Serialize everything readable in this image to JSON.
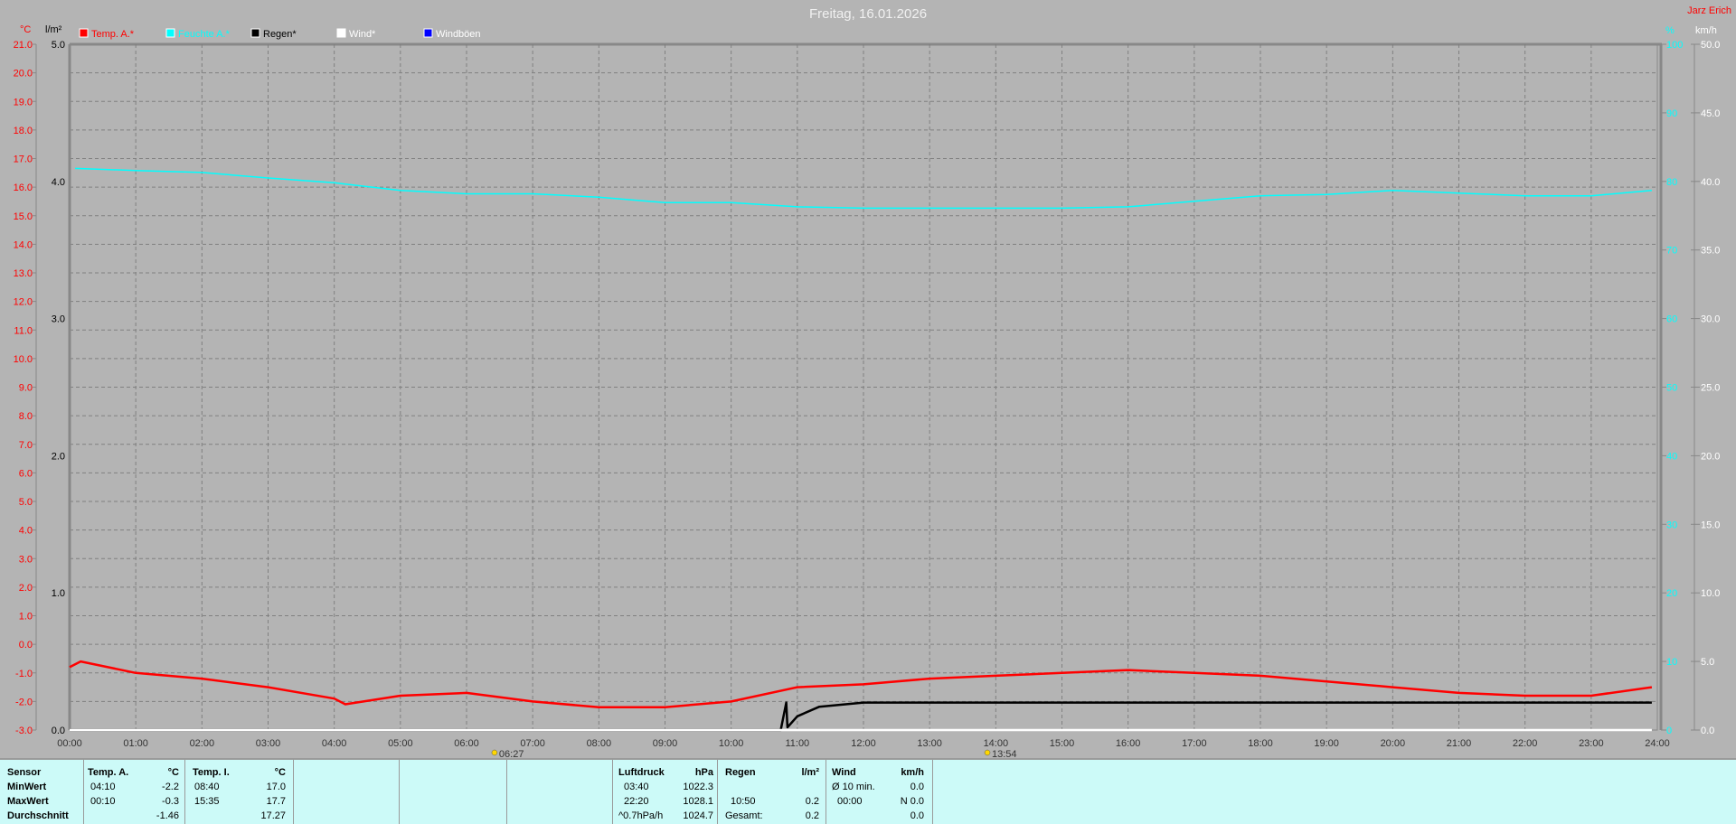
{
  "title": "Freitag, 16.01.2026",
  "station_owner": "Jarz Erich",
  "colors": {
    "temp": "#ff0000",
    "humidity": "#00ffff",
    "rain": "#000000",
    "wind": "#ffffff",
    "gusts": "#0000ff",
    "background": "#b4b4b4",
    "table": "#ccfaf8"
  },
  "chart_data": {
    "type": "line",
    "title": "Freitag, 16.01.2026",
    "x_ticks": [
      "00:00",
      "01:00",
      "02:00",
      "03:00",
      "04:00",
      "05:00",
      "06:00",
      "07:00",
      "08:00",
      "09:00",
      "10:00",
      "11:00",
      "12:00",
      "13:00",
      "14:00",
      "15:00",
      "16:00",
      "17:00",
      "18:00",
      "19:00",
      "20:00",
      "21:00",
      "22:00",
      "23:00",
      "24:00"
    ],
    "xlim_hours": [
      0,
      24
    ],
    "grid": true,
    "legend_placement": "top-left",
    "axes": {
      "temp": {
        "unit": "°C",
        "ylim": [
          -3,
          21
        ],
        "ticks": [
          "21.0",
          "20.0",
          "19.0",
          "18.0",
          "17.0",
          "16.0",
          "15.0",
          "14.0",
          "13.0",
          "12.0",
          "11.0",
          "10.0",
          "9.0",
          "8.0",
          "7.0",
          "6.0",
          "5.0",
          "4.0",
          "3.0",
          "2.0",
          "1.0",
          "0.0",
          "-1.0",
          "-2.0",
          "-3.0"
        ]
      },
      "rain": {
        "unit": "l/m²",
        "ylim": [
          0,
          5
        ],
        "ticks": [
          "5.0",
          "4.0",
          "3.0",
          "2.0",
          "1.0",
          "0.0"
        ]
      },
      "humidity": {
        "unit": "%",
        "ylim": [
          0,
          100
        ],
        "ticks": [
          "100",
          "90",
          "80",
          "70",
          "60",
          "50",
          "40",
          "30",
          "20",
          "10",
          "0"
        ]
      },
      "wind": {
        "unit": "km/h",
        "ylim": [
          0,
          50
        ],
        "ticks": [
          "50.0",
          "45.0",
          "40.0",
          "35.0",
          "30.0",
          "25.0",
          "20.0",
          "15.0",
          "10.0",
          "5.0",
          "0.0"
        ]
      }
    },
    "series": [
      {
        "name": "Temp. A.*",
        "axis": "temp",
        "color": "#ff0000",
        "x": [
          "00:00",
          "00:10",
          "01:00",
          "02:00",
          "03:00",
          "04:00",
          "04:10",
          "05:00",
          "06:00",
          "07:00",
          "08:00",
          "09:00",
          "10:00",
          "11:00",
          "12:00",
          "13:00",
          "14:00",
          "15:00",
          "16:00",
          "17:00",
          "18:00",
          "19:00",
          "20:00",
          "21:00",
          "22:00",
          "23:00",
          "23:55"
        ],
        "y": [
          -0.8,
          -0.6,
          -1.0,
          -1.2,
          -1.5,
          -1.9,
          -2.1,
          -1.8,
          -1.7,
          -2.0,
          -2.2,
          -2.2,
          -2.0,
          -1.5,
          -1.4,
          -1.2,
          -1.1,
          -1.0,
          -0.9,
          -1.0,
          -1.1,
          -1.3,
          -1.5,
          -1.7,
          -1.8,
          -1.8,
          -1.5
        ]
      },
      {
        "name": "Feuchte A.*",
        "axis": "humidity",
        "color": "#00ffff",
        "x": [
          "00:05",
          "01:00",
          "02:00",
          "03:00",
          "04:00",
          "05:00",
          "06:00",
          "07:00",
          "08:00",
          "09:00",
          "10:00",
          "11:00",
          "12:00",
          "13:00",
          "14:00",
          "15:00",
          "16:00",
          "17:00",
          "18:00",
          "19:00",
          "20:00",
          "21:00",
          "22:00",
          "23:00",
          "23:55"
        ],
        "y": [
          81.9,
          81.6,
          81.3,
          80.5,
          79.8,
          78.7,
          78.2,
          78.2,
          77.7,
          76.9,
          76.9,
          76.3,
          76.1,
          76.1,
          76.1,
          76.1,
          76.3,
          77.1,
          77.9,
          78.1,
          78.7,
          78.3,
          77.9,
          77.9,
          78.7
        ]
      },
      {
        "name": "Regen*",
        "axis": "rain",
        "color": "#000000",
        "x": [
          "00:00",
          "10:45",
          "10:50",
          "10:51",
          "11:00",
          "11:20",
          "12:00",
          "23:55"
        ],
        "y": [
          0,
          0,
          0.2,
          0.02,
          0.1,
          0.17,
          0.2,
          0.2
        ]
      },
      {
        "name": "Wind*",
        "axis": "wind",
        "color": "#ffffff",
        "x": [
          "00:00",
          "23:55"
        ],
        "y": [
          0,
          0
        ]
      },
      {
        "name": "Windböen",
        "axis": "wind",
        "color": "#0000ff",
        "x": [],
        "y": []
      }
    ],
    "annotations": [
      {
        "label": "06:27",
        "x": "06:27",
        "icon": "sunrise-icon"
      },
      {
        "label": "13:54",
        "x": "13:54",
        "icon": "sunset-icon"
      }
    ]
  },
  "stats": {
    "row_labels": [
      "Sensor",
      "MinWert",
      "MaxWert",
      "Durchschnitt"
    ],
    "temp_a": {
      "header": "Temp. A.",
      "unit": "°C",
      "min_time": "04:10",
      "min": "-2.2",
      "max_time": "00:10",
      "max": "-0.3",
      "avg": "-1.46"
    },
    "temp_i": {
      "header": "Temp. I.",
      "unit": "°C",
      "min_time": "08:40",
      "min": "17.0",
      "max_time": "15:35",
      "max": "17.7",
      "avg": "17.27"
    },
    "pressure": {
      "header": "Luftdruck",
      "unit": "hPa",
      "min_time": "03:40",
      "min": "1022.3",
      "max_time": "22:20",
      "max": "1028.1",
      "trend": "^0.7hPa/h",
      "avg": "1024.7"
    },
    "rain": {
      "header": "Regen",
      "unit": "l/m²",
      "max_time": "10:50",
      "max": "0.2",
      "total_label": "Gesamt:",
      "total": "0.2"
    },
    "wind": {
      "header": "Wind",
      "unit": "km/h",
      "avg_label": "Ø 10 min.",
      "avg": "0.0",
      "max_time": "00:00",
      "max": "N 0.0",
      "last": "0.0"
    }
  }
}
